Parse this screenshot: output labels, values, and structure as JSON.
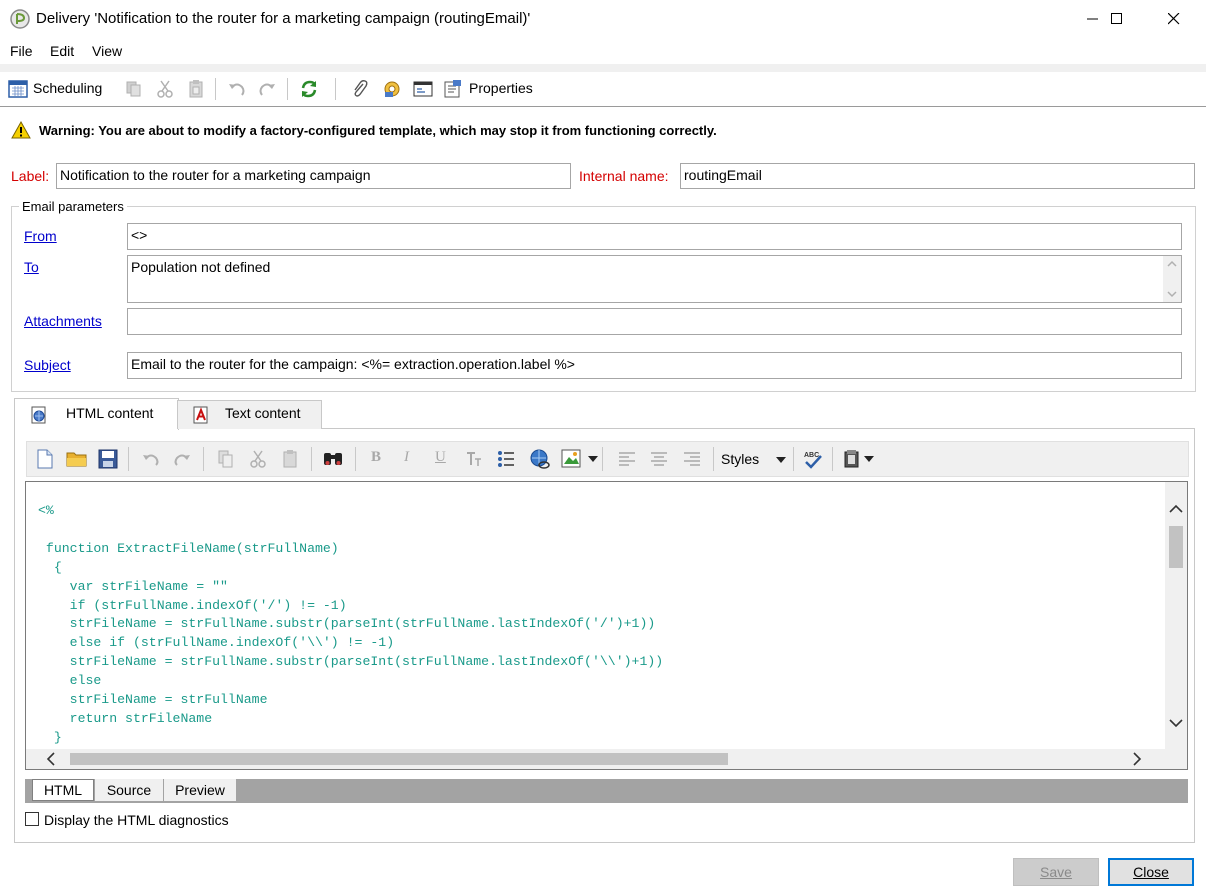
{
  "window": {
    "title": "Delivery 'Notification to the router for a marketing campaign (routingEmail)'",
    "minimize_glyph": "—",
    "maximize_glyph": "☐",
    "close_glyph": "✕"
  },
  "menu": [
    "File",
    "Edit",
    "View"
  ],
  "toolbar": {
    "scheduling_label": "Scheduling",
    "properties_label": "Properties"
  },
  "warning": {
    "text": "Warning: You are about to modify a factory-configured template, which may stop it from functioning correctly."
  },
  "form": {
    "label_caption": "Label:",
    "label_value": "Notification to the router for a marketing campaign",
    "internal_name_caption": "Internal name:",
    "internal_name_value": "routingEmail"
  },
  "email_params": {
    "legend": "Email parameters",
    "from_label": "From",
    "from_value": "<>",
    "to_label": "To",
    "to_value": "Population not defined",
    "attachments_label": "Attachments",
    "attachments_value": "",
    "subject_label": "Subject",
    "subject_value": "Email to the router for the campaign: <%= extraction.operation.label %>"
  },
  "content_tabs": {
    "html_label": "HTML content",
    "text_label": "Text content"
  },
  "editor": {
    "styles_label": "Styles",
    "code": "<%\n\n function ExtractFileName(strFullName)\n  {\n    var strFileName = \"\"\n    if (strFullName.indexOf('/') != -1)\n    strFileName = strFullName.substr(parseInt(strFullName.lastIndexOf('/')+1))\n    else if (strFullName.indexOf('\\\\') != -1)\n    strFileName = strFullName.substr(parseInt(strFullName.lastIndexOf('\\\\')+1))\n    else\n    strFileName = strFullName\n    return strFileName\n  }",
    "view_tabs": [
      "HTML",
      "Source",
      "Preview"
    ]
  },
  "diagnostics_label": "Display the HTML diagnostics",
  "buttons": {
    "save_label": "Save",
    "close_label": "Close"
  }
}
